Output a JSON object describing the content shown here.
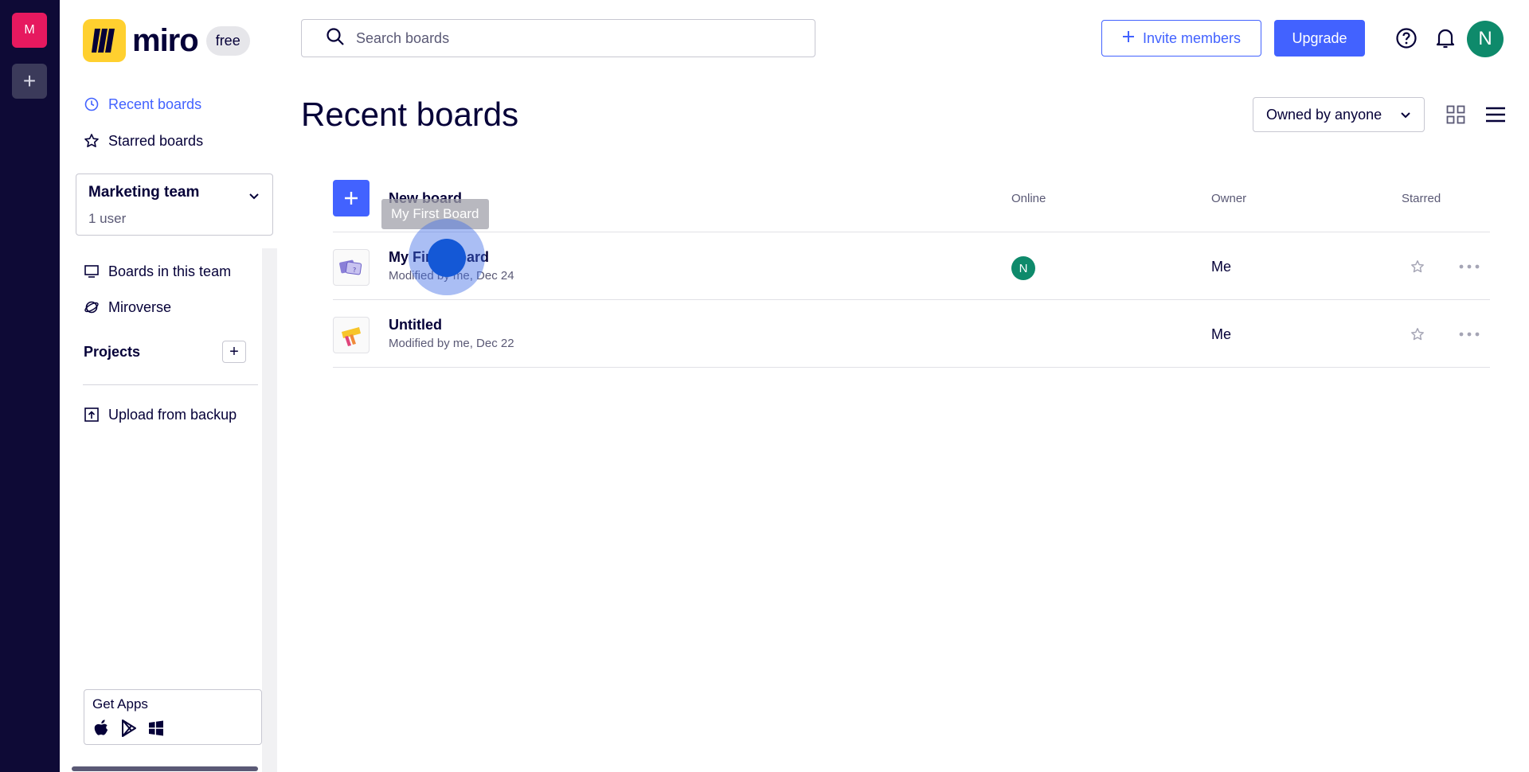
{
  "rail": {
    "team_initial": "M",
    "add_label": "+"
  },
  "brand": {
    "name": "miro",
    "plan": "free"
  },
  "sidebar": {
    "nav_top": [
      {
        "label": "Recent boards",
        "icon": "clock-icon",
        "active": true
      },
      {
        "label": "Starred boards",
        "icon": "star-icon",
        "active": false
      }
    ],
    "team": {
      "name": "Marketing team",
      "users": "1 user"
    },
    "nav_team": [
      {
        "label": "Boards in this team",
        "icon": "board-icon"
      },
      {
        "label": "Miroverse",
        "icon": "miroverse-icon"
      }
    ],
    "projects_title": "Projects",
    "projects_add": "+",
    "upload_label": "Upload from backup",
    "get_apps_label": "Get Apps"
  },
  "header": {
    "search_placeholder": "Search boards",
    "invite_label": "Invite members",
    "upgrade_label": "Upgrade",
    "avatar_initial": "N"
  },
  "main": {
    "title": "Recent boards",
    "owner_filter": "Owned by anyone",
    "new_board_label": "New board",
    "columns": {
      "online": "Online",
      "owner": "Owner",
      "starred": "Starred"
    },
    "boards": [
      {
        "name": "My First Board",
        "meta": "Modified by me, Dec 24",
        "online_initial": "N",
        "owner": "Me"
      },
      {
        "name": "Untitled",
        "meta": "Modified by me, Dec 22",
        "online_initial": "",
        "owner": "Me"
      }
    ],
    "tooltip": "My First Board"
  },
  "colors": {
    "accent": "#4262ff",
    "rail": "#0e0a36",
    "team_badge": "#e6195f",
    "avatar": "#0e8a6b",
    "logo": "#ffd02f"
  }
}
